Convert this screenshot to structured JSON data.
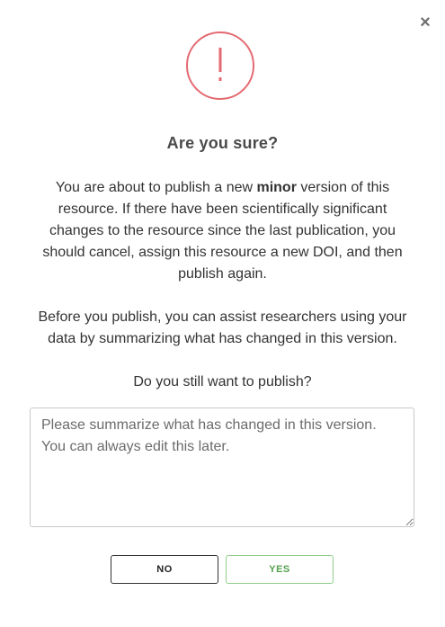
{
  "dialog": {
    "close_glyph": "×",
    "alert_icon": "exclamation-circle-icon",
    "alert_color": "#e46a72",
    "title": "Are you sure?",
    "paragraph1": {
      "before": "You are about to publish a new ",
      "emphasis": "minor",
      "after": " version of this resource. If there have been scientifically significant changes to the resource since the last publication, you should cancel, assign this resource a new DOI, and then publish again."
    },
    "paragraph2": "Before you publish, you can assist researchers using your data by summarizing what has changed in this version.",
    "question": "Do you still want to publish?",
    "summary_placeholder": "Please summarize what has changed in this version.\nYou can always edit this later.",
    "summary_value": "",
    "buttons": {
      "no_label": "NO",
      "yes_label": "YES",
      "yes_color": "#53a04e"
    }
  }
}
